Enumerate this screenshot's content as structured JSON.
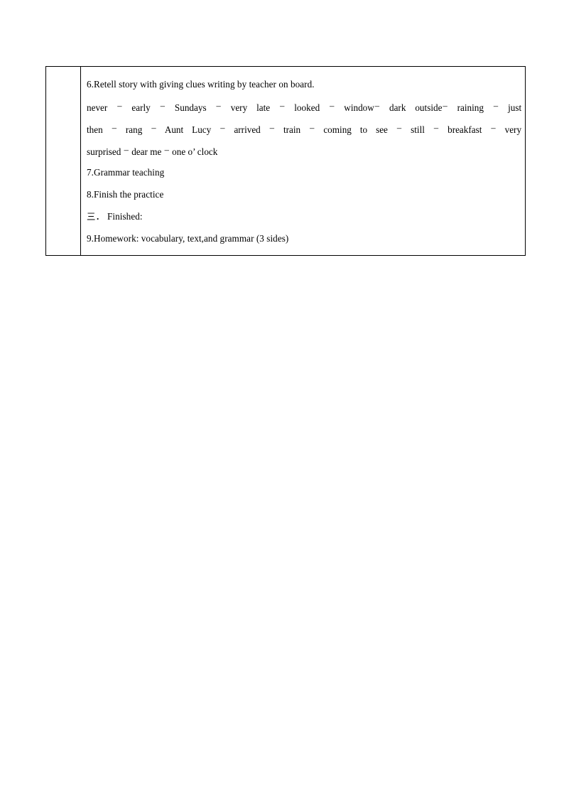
{
  "document": {
    "type": "lesson-plan-table",
    "page_background": "#ffffff",
    "border_color": "#000000",
    "label_column_text": ""
  },
  "table": {
    "rows": [
      {
        "id": "row-retell",
        "kind": "numbered-item",
        "text": "6.Retell story with giving clues writing by teacher on board."
      },
      {
        "id": "row-clues",
        "kind": "clue-lines",
        "separator": "–",
        "lines": [
          {
            "id": "clue-line-1",
            "justified": true,
            "tokens": [
              "never",
              "early",
              "Sundays",
              "very late",
              "looked",
              "window",
              "dark outside",
              "raining",
              "just"
            ]
          },
          {
            "id": "clue-line-2",
            "justified": true,
            "tokens": [
              "then",
              "rang",
              "Aunt Lucy",
              "arrived",
              "train",
              "coming to see",
              "still",
              "breakfast",
              "very"
            ]
          },
          {
            "id": "clue-line-3",
            "justified": false,
            "tokens": [
              "surprised",
              "dear me",
              "one o’ clock"
            ]
          }
        ]
      },
      {
        "id": "row-grammar",
        "kind": "numbered-item",
        "text": "7.Grammar teaching"
      },
      {
        "id": "row-practice",
        "kind": "numbered-item",
        "text": "8.Finish the practice"
      },
      {
        "id": "row-finished-heading",
        "kind": "section-heading",
        "marker": "三",
        "text": "． Finished:"
      },
      {
        "id": "row-homework",
        "kind": "numbered-item",
        "text": "9.Homework: vocabulary, text,and grammar (3 sides)"
      }
    ]
  }
}
